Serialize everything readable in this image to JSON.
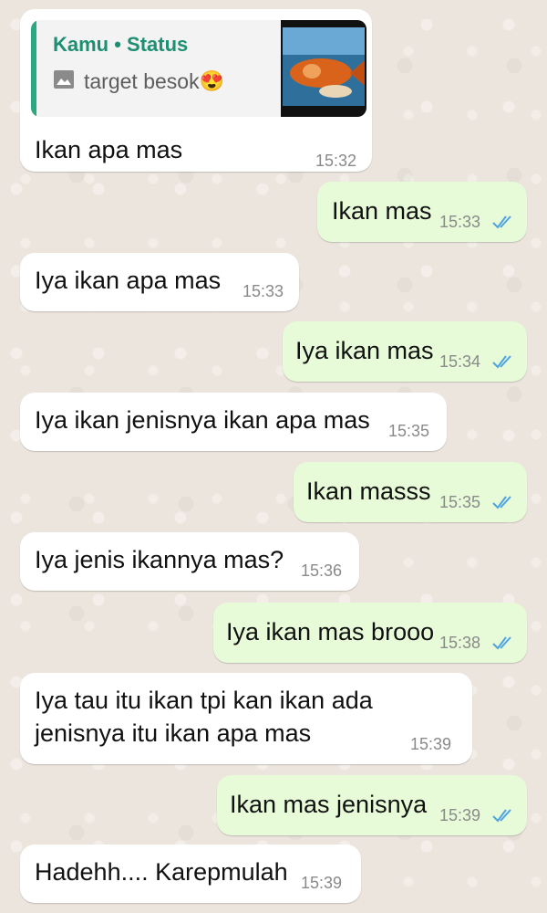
{
  "quoted_status": {
    "author": "Kamu • Status",
    "caption": "target besok",
    "emoji": "😍",
    "icon": "image-icon"
  },
  "messages": [
    {
      "direction": "in",
      "text": "Ikan apa mas",
      "time": "15:32"
    },
    {
      "direction": "out",
      "text": "Ikan mas",
      "time": "15:33",
      "status": "read"
    },
    {
      "direction": "in",
      "text": "Iya ikan apa mas",
      "time": "15:33"
    },
    {
      "direction": "out",
      "text": "Iya ikan mas",
      "time": "15:34",
      "status": "read"
    },
    {
      "direction": "in",
      "text": "Iya ikan jenisnya ikan apa mas",
      "time": "15:35"
    },
    {
      "direction": "out",
      "text": "Ikan masss",
      "time": "15:35",
      "status": "read"
    },
    {
      "direction": "in",
      "text": "Iya jenis ikannya mas?",
      "time": "15:36"
    },
    {
      "direction": "out",
      "text": "Iya ikan mas brooo",
      "time": "15:38",
      "status": "read"
    },
    {
      "direction": "in",
      "text": "Iya tau itu ikan tpi kan ikan ada\njenisnya itu ikan apa mas",
      "time": "15:39"
    },
    {
      "direction": "out",
      "text": "Ikan mas jenisnya",
      "time": "15:39",
      "status": "read"
    },
    {
      "direction": "in",
      "text": "Hadehh.... Karepmulah",
      "time": "15:39"
    }
  ],
  "colors": {
    "incoming": "#ffffff",
    "outgoing": "#e7fbd8",
    "read_ticks": "#4fa3e0",
    "quote_accent": "#2aa882"
  }
}
